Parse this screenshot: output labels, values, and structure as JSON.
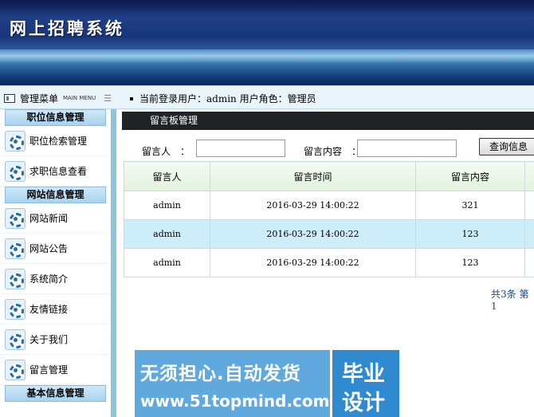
{
  "app": {
    "title": "网上招聘系统"
  },
  "infobar": {
    "menu_label": "管理菜单",
    "menu_label_en": "MAIN MENU",
    "menu_bars": "☰",
    "current_user_text": "当前登录用户：admin 用户角色：管理员"
  },
  "sidebar": {
    "groups": [
      {
        "title": "职位信息管理",
        "items": [
          "职位检索管理",
          "求职信息查看"
        ]
      },
      {
        "title": "网站信息管理",
        "items": [
          "网站新闻",
          "网站公告",
          "系统简介",
          "友情链接",
          "关于我们",
          "留言管理"
        ]
      },
      {
        "title": "基本信息管理",
        "items": []
      }
    ]
  },
  "panel": {
    "title": "留言板管理",
    "search": {
      "person_label": "留言人　：",
      "person_value": "",
      "content_label": "留言内容　：",
      "content_value": "",
      "button_label": "查询信息"
    },
    "table": {
      "headers": [
        "留言人",
        "留言时间",
        "留言内容"
      ],
      "rows": [
        {
          "person": "admin",
          "time": "2016-03-29 14:00:22",
          "content": "321"
        },
        {
          "person": "admin",
          "time": "2016-03-29 14:00:22",
          "content": "123"
        },
        {
          "person": "admin",
          "time": "2016-03-29 14:00:22",
          "content": "123"
        }
      ]
    },
    "pager_text": "共3条  第1"
  },
  "watermark": {
    "line1": "无须担心.自动发货",
    "line2": "www.51topmind.com",
    "right1": "毕业",
    "right2": "设计"
  },
  "colors": {
    "header_dark": "#0a1a4a",
    "panel_head": "#202326",
    "highlight_row": "#cdeef9",
    "sidebar_border": "#8fc4dd",
    "watermark_blue": "#5fa9de"
  }
}
